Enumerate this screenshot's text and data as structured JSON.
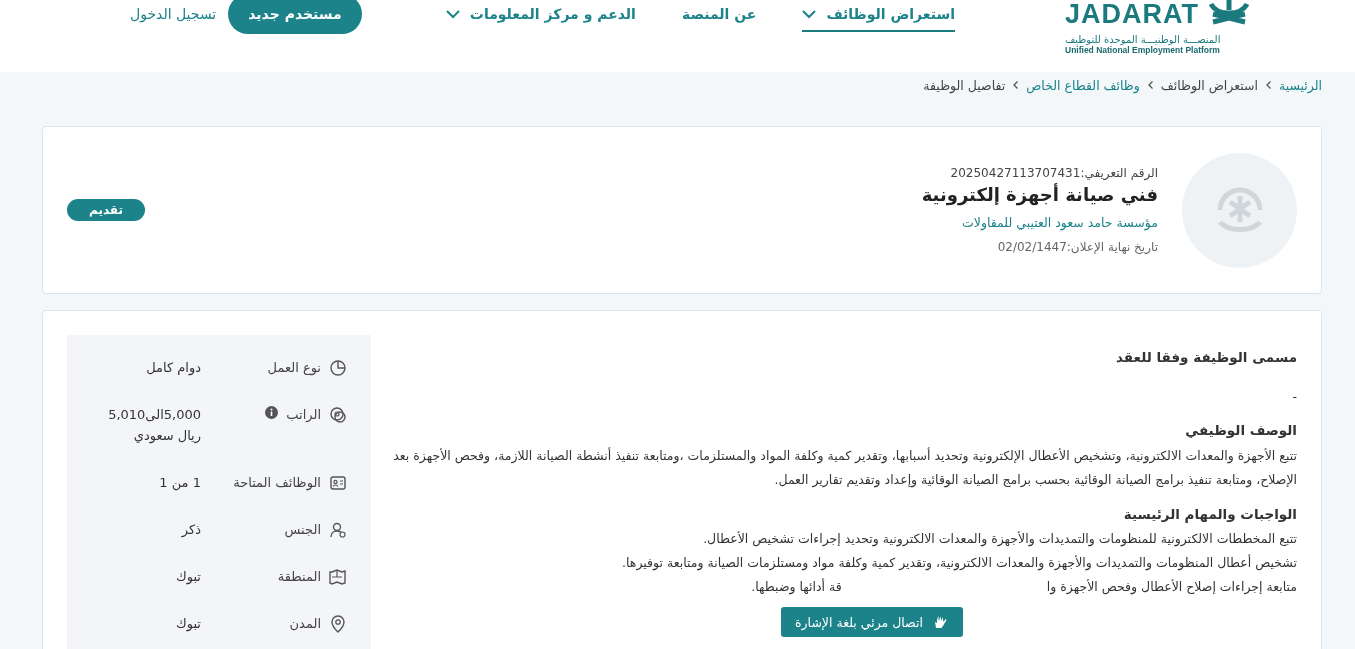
{
  "logo": {
    "name": "JADARAT",
    "subtitle_ar": "المنصـــة الوطنيـــة الموحدة للتوظيف",
    "subtitle_en": "Unified National Employment Platform"
  },
  "nav": [
    {
      "label": "استعراض الوظائف",
      "selected": true,
      "dropdown": true
    },
    {
      "label": "عن المنصة",
      "selected": false,
      "dropdown": false
    },
    {
      "label": "الدعم و مركز المعلومات",
      "selected": false,
      "dropdown": true
    }
  ],
  "register_button": "مستخدم جديد",
  "login_link": "تسجيل الدخول",
  "breadcrumb": [
    {
      "label": "الرئيسية",
      "link": true
    },
    {
      "label": "استعراض الوظائف",
      "link": false
    },
    {
      "label": "وظائف القطاع الخاص",
      "link": true
    },
    {
      "label": "تفاصيل الوظيفة",
      "link": false
    }
  ],
  "job": {
    "reference": "الرقم التعريفي:20250427113707431",
    "title": "فني صيانة أجهزة إلكترونية",
    "company": "مؤسسة حامد سعود العتيبي للمقاولات",
    "deadline": "تاريخ نهاية الإعلان:02/02/1447",
    "apply_button": "تقديم"
  },
  "details": [
    {
      "label": "نوع العمل",
      "value": "دوام كامل",
      "info": false
    },
    {
      "label": "الراتب",
      "value": "5,000الى5,010 ريال سعودي",
      "info": true
    },
    {
      "label": "الوظائف المتاحة",
      "value": "1 من 1",
      "info": false
    },
    {
      "label": "الجنس",
      "value": "ذكر",
      "info": false
    },
    {
      "label": "المنطقة",
      "value": "تبوك",
      "info": false
    },
    {
      "label": "المدن",
      "value": "تبوك",
      "info": false
    }
  ],
  "sections": [
    {
      "heading": "مسمى الوظيفة وفقا للعقد",
      "lines": [
        "-"
      ]
    },
    {
      "heading": "الوصف الوظيفي",
      "lines": [
        "تتبع الأجهزة والمعدات الالكترونية، وتشخيص الأعطال الإلكترونية وتحديد أسبابها، وتقدير كمية وكلفة المواد والمستلزمات ،ومتابعة تنفيذ أنشطة الصيانة اللازمة، وفحص الأجهزة بعد الإصلاح، ومتابعة تنفيذ برامج الصيانة الوقائية بحسب برامج الصيانة الوقائية وإعداد وتقديم تقارير العمل."
      ]
    },
    {
      "heading": "الواجبات والمهام الرئيسية",
      "lines": [
        "تتبع المخططات الالكترونية للمنظومات والتمديدات والأجهزة والمعدات الالكترونية وتحديد إجراءات تشخيص الأعطال.",
        "تشخيص أعطال المنظومات والتمديدات والأجهزة والمعدات الالكترونية، وتقدير كمية وكلفة مواد ومستلزمات الصيانة ومتابعة توفيرها."
      ],
      "covered_line": [
        "متابعة إجراءات إصلاح الأعطال وفحص الأجهزة وا",
        "قة أدائها وضبطها."
      ]
    }
  ],
  "sign_language_button": "اتصال مرئي بلغة الإشارة"
}
